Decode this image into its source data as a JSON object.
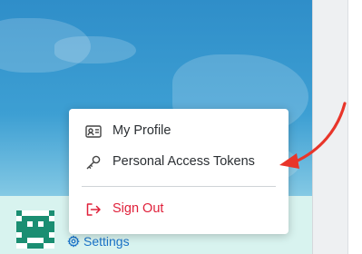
{
  "menu": {
    "items": [
      {
        "label": "My Profile",
        "icon": "id-card-icon"
      },
      {
        "label": "Personal Access Tokens",
        "icon": "key-icon"
      },
      {
        "label": "Sign Out",
        "icon": "sign-out-icon"
      }
    ]
  },
  "footer": {
    "settings_label": "Settings",
    "settings_icon": "gear-icon",
    "avatar_icon": "pixel-avatar-icon"
  },
  "annotation": {
    "arrow_icon": "red-arrow-icon"
  },
  "colors": {
    "accent_link": "#1a73c8",
    "danger": "#e0203a",
    "annotation_arrow": "#e8352a",
    "avatar": "#1a8e72",
    "footer_background": "#d8f3ef"
  }
}
